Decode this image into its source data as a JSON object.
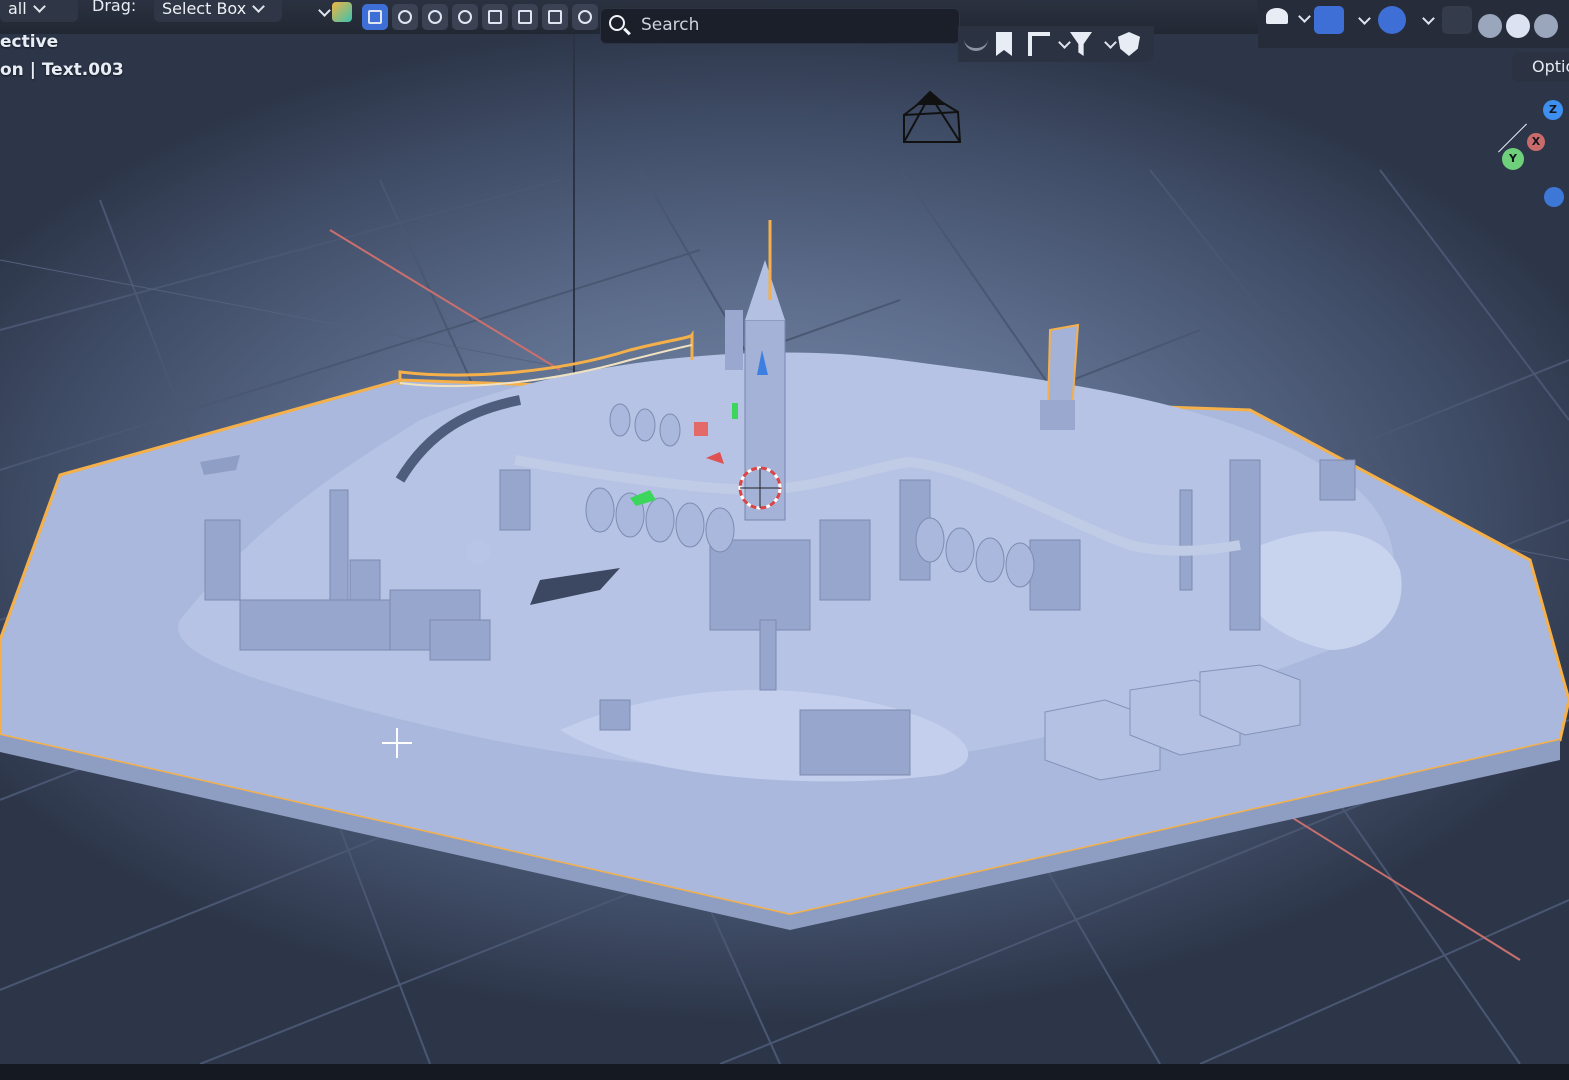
{
  "header": {
    "left_fragment": "all",
    "drag_label": "Drag:",
    "drag_mode": "Select Box",
    "search_placeholder": "Search"
  },
  "viewport": {
    "view_label": "ective",
    "object_label": "on | Text.003",
    "options_label": "Optio"
  },
  "gizmo": {
    "z_label": "Z",
    "y_label": "Y",
    "x_label": "X"
  },
  "colors": {
    "accent": "#3d6fd6",
    "selection_outline": "#f5b04a",
    "model": "#aebce0",
    "grid": "#4a5772"
  },
  "icons": {
    "toolbar": [
      "select-icon",
      "sphere-icon",
      "sculpt-icon",
      "globe-icon",
      "hand-icon",
      "paint-icon",
      "stack-icon",
      "undo-icon"
    ],
    "filter": [
      "hide-icon",
      "bookmark-icon",
      "hierarchy-icon",
      "filter-icon",
      "shield-icon"
    ],
    "right": [
      "visibility-icon",
      "gizmo-icon",
      "overlay-icon",
      "xray-icon",
      "shading-icon"
    ]
  }
}
